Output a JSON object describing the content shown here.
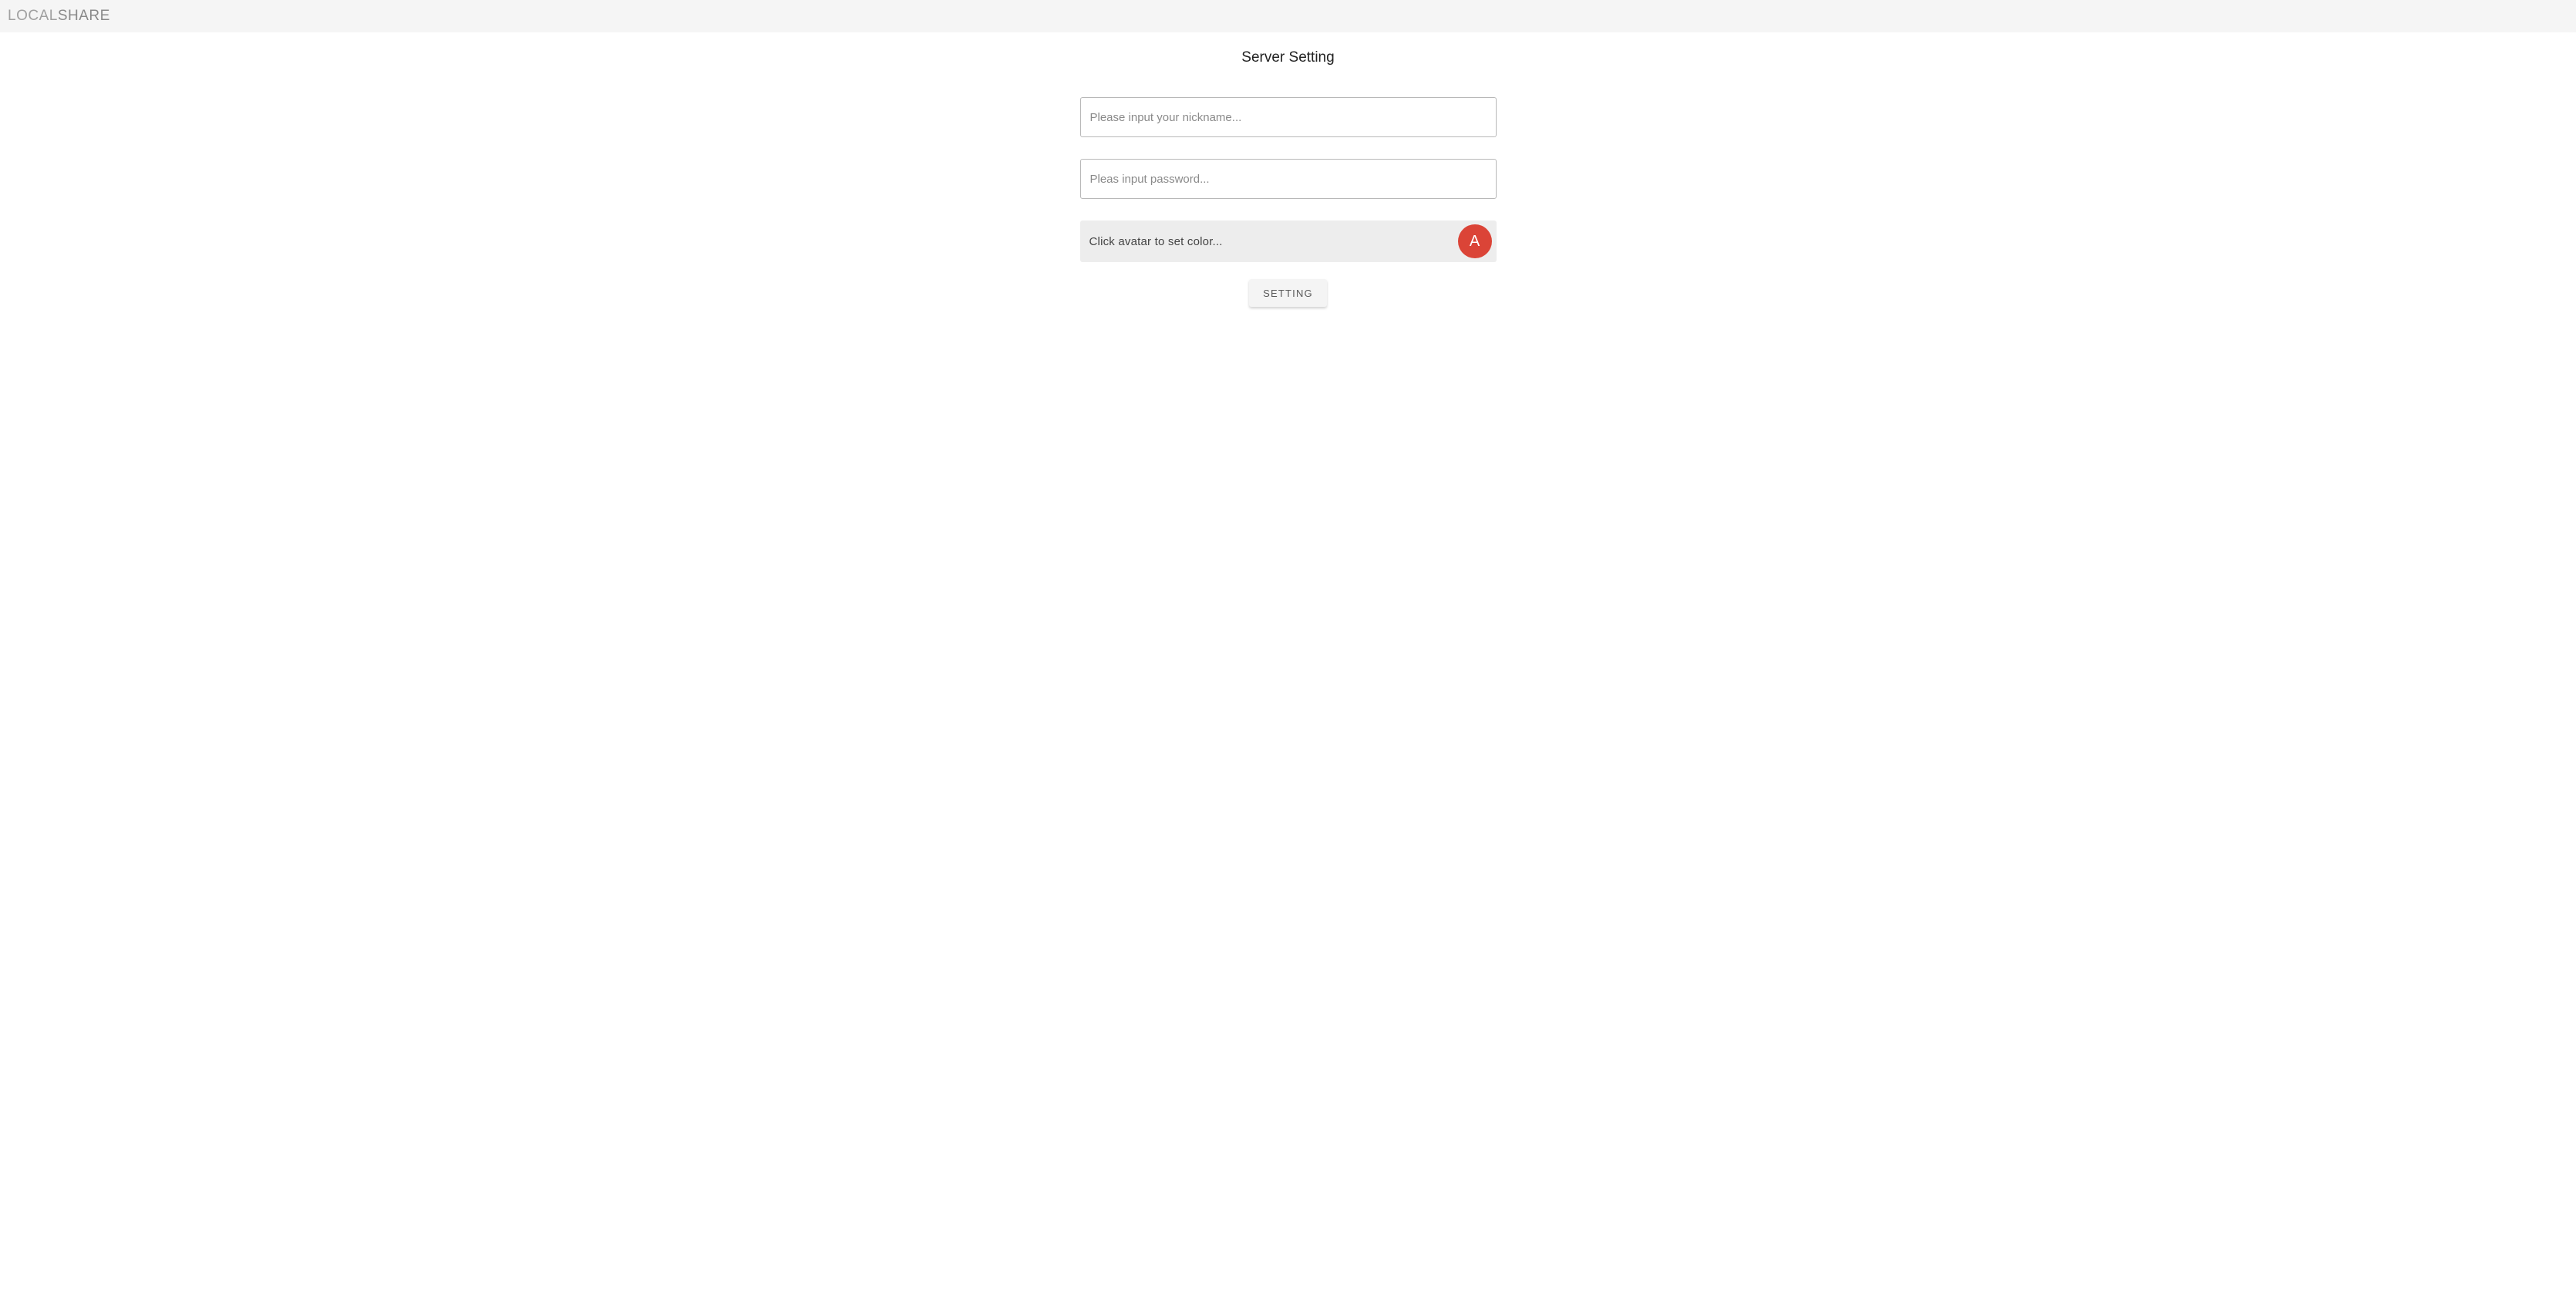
{
  "header": {
    "brand_part1": "Local",
    "brand_part2": "Share"
  },
  "page": {
    "title": "Server Setting"
  },
  "form": {
    "nickname": {
      "value": "",
      "placeholder": "Please input your nickname..."
    },
    "password": {
      "value": "",
      "placeholder": "Pleas input password..."
    },
    "avatar_row": {
      "label": "Click avatar to set color...",
      "avatar_letter": "A",
      "avatar_color": "#db4437"
    },
    "submit_label": "Setting"
  }
}
